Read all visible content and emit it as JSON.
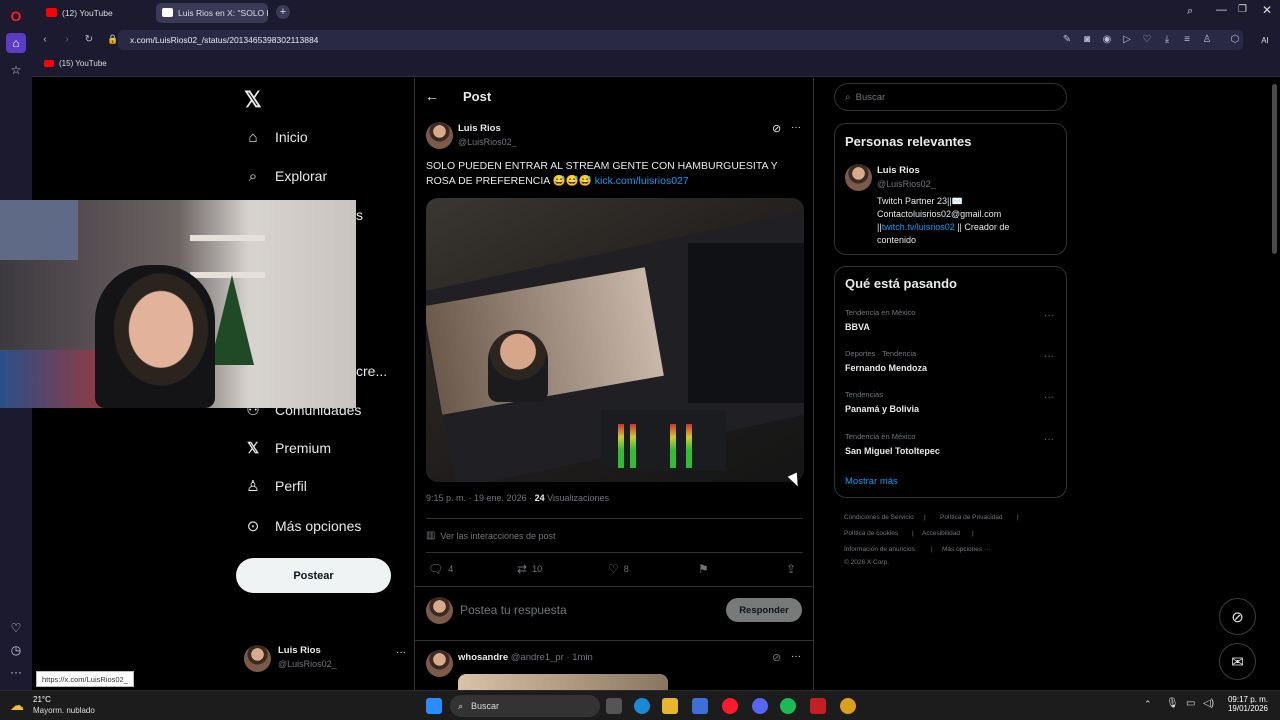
{
  "browser": {
    "tabs": [
      {
        "title": "(12) YouTube",
        "active": false
      },
      {
        "title": "Luis Rios en X: \"SOLO PUE",
        "active": true
      }
    ],
    "url": "x.com/LuisRios02_/status/2013465398302113884",
    "bookmarks": [
      {
        "label": "(15) YouTube"
      }
    ],
    "status_url": "https://x.com/LuisRios02_",
    "ai_label": "AI"
  },
  "nav": {
    "items": [
      {
        "label": "Inicio",
        "icon": "home-icon"
      },
      {
        "label": "Explorar",
        "icon": "search-icon"
      },
      {
        "label": "Comunidades",
        "icon": "communities-icon"
      },
      {
        "label": "Premium",
        "icon": "x-logo-icon"
      },
      {
        "label": "Perfil",
        "icon": "profile-icon"
      },
      {
        "label": "Más opciones",
        "icon": "more-options-icon"
      }
    ],
    "hidden_fragments": [
      "s",
      "cre..."
    ],
    "post_button": "Postear",
    "account": {
      "name": "Luis Rios",
      "handle": "@LuisRios02_"
    }
  },
  "post": {
    "header": "Post",
    "author": {
      "name": "Luis Rios",
      "handle": "@LuisRios02_"
    },
    "text": "SOLO PUEDEN ENTRAR AL STREAM GENTE CON HAMBURGUESITA Y ROSA DE PREFERENCIA 😅😅😅",
    "link": "kick.com/luisrios027",
    "meta": {
      "time": "9:15 p. m.",
      "date": "19 ene. 2026",
      "views": "24",
      "views_label": "Visualizaciones"
    },
    "interactions_label": "Ver las interacciones de post",
    "counts": {
      "replies": "4",
      "reposts": "10",
      "likes": "8"
    },
    "reply_placeholder": "Postea tu respuesta",
    "reply_button": "Responder"
  },
  "next_reply": {
    "name": "whosandre",
    "handle": "@andre1_pr",
    "time": "1min"
  },
  "sidebar": {
    "search_placeholder": "Buscar",
    "relevant": {
      "title": "Personas relevantes",
      "name": "Luis Rios",
      "handle": "@LuisRios02_",
      "bio_1": "Twitch Partner 23||✉️",
      "bio_2": "Contactoluisrios02@gmail.com",
      "bio_3_prefix": "||",
      "bio_3_link": "twitch.tv/luisrios02",
      "bio_3_suffix": " || Creador de",
      "bio_4": "contenido"
    },
    "trends_title": "Qué está pasando",
    "trends": [
      {
        "meta": "Tendencia en México",
        "name": "BBVA"
      },
      {
        "meta": "Deportes · Tendencia",
        "name": "Fernando Mendoza"
      },
      {
        "meta": "Tendencias",
        "name": "Panamá y Bolivia"
      },
      {
        "meta": "Tendencia en México",
        "name": "San Miguel Totoltepec"
      }
    ],
    "show_more": "Mostrar más",
    "footer": {
      "terms": "Condiciones de Servicio",
      "privacy": "Política de Privacidad",
      "cookies": "Política de cookies",
      "accessibility": "Accesibilidad",
      "ads": "Información de anuncios",
      "more": "Más opciones ···",
      "copyright": "© 2026 X Corp."
    }
  },
  "taskbar": {
    "weather_temp": "21°C",
    "weather_desc": "Mayorm. nublado",
    "search_label": "Buscar",
    "time": "09:17 p. m.",
    "date": "19/01/2026"
  },
  "colors": {
    "accent_blue": "#1d9bf0",
    "x_background": "#000000",
    "browser_chrome": "#1b1a2e",
    "opera_red": "#ff1b2d"
  }
}
